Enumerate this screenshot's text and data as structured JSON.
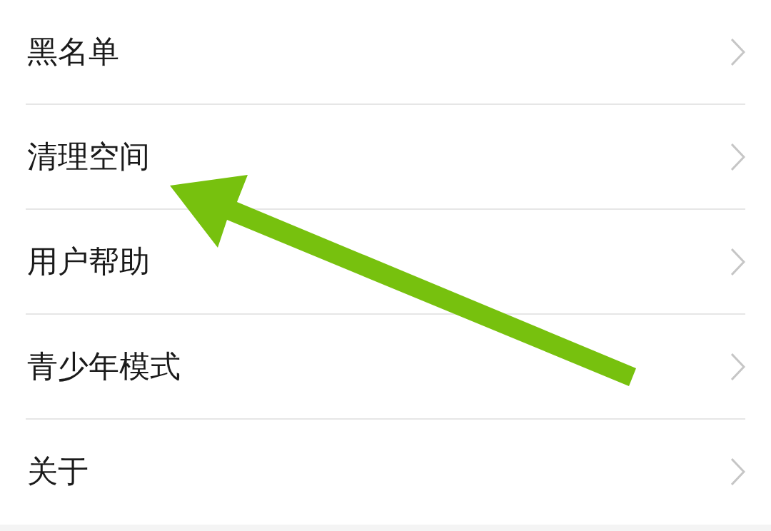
{
  "settings_list": {
    "items": [
      {
        "label": "黑名单"
      },
      {
        "label": "清理空间"
      },
      {
        "label": "用户帮助"
      },
      {
        "label": "青少年模式"
      },
      {
        "label": "关于"
      }
    ]
  }
}
